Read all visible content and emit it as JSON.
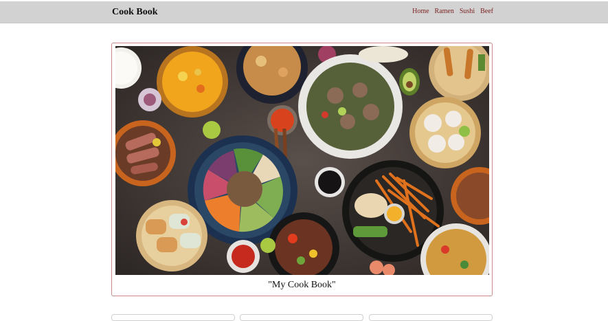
{
  "navbar": {
    "brand": "Cook Book",
    "links": [
      "Home",
      "Ramen",
      "Sushi",
      "Beef"
    ]
  },
  "hero": {
    "caption": "\"My Cook Book\""
  },
  "colors": {
    "navbar_bg": "#d3d2d2",
    "link": "#7a2323",
    "card_border": "#c98a8a"
  }
}
